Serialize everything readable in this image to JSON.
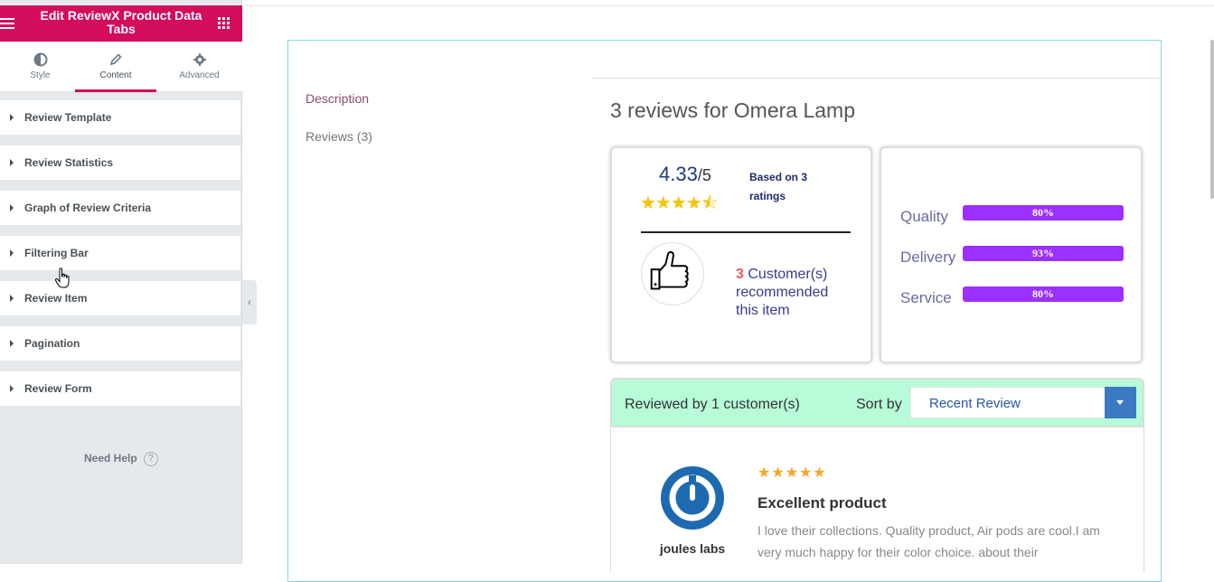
{
  "panel": {
    "title": "Edit ReviewX Product Data Tabs",
    "tabs": [
      {
        "label": "Style",
        "icon": "contrast-icon"
      },
      {
        "label": "Content",
        "icon": "pencil-icon",
        "active": true
      },
      {
        "label": "Advanced",
        "icon": "gear-icon"
      }
    ],
    "sections": [
      "Review Template",
      "Review Statistics",
      "Graph of Review Criteria",
      "Filtering Bar",
      "Review Item",
      "Pagination",
      "Review Form"
    ],
    "help": {
      "label": "Need Help",
      "icon": "question-icon"
    },
    "accent_color": "#d30c5c"
  },
  "preview": {
    "tabs": [
      {
        "label": "Description"
      },
      {
        "label": "Reviews (3)"
      }
    ],
    "heading": "3 reviews for Omera Lamp",
    "summary": {
      "average": "4.33",
      "out_of": "/5",
      "stars": "★★★★⯪",
      "based_on": "Based on 3 ratings",
      "recommend_count": "3",
      "recommend_text": "Customer(s) recommended this item"
    },
    "criteria": [
      {
        "label": "Quality",
        "percent": 80,
        "text": "80%"
      },
      {
        "label": "Delivery",
        "percent": 93,
        "text": "93%"
      },
      {
        "label": "Service",
        "percent": 80,
        "text": "80%"
      }
    ],
    "filter": {
      "reviewed_by": "Reviewed by 1 customer(s)",
      "sort_label": "Sort by",
      "sort_value": "Recent Review"
    },
    "review": {
      "stars": "★★★★★",
      "title": "Excellent product",
      "body": "I love their collections. Quality product, Air pods are cool.I am very much happy for their color choice. about their",
      "reviewer": "joules labs"
    },
    "bar_color": "#9b30ff",
    "filter_bg": "#b7fbd9"
  }
}
